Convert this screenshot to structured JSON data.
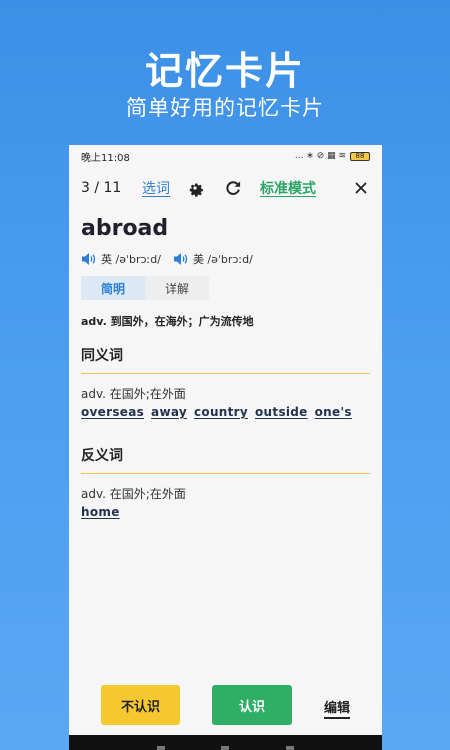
{
  "hero": {
    "title": "记忆卡片",
    "subtitle": "简单好用的记忆卡片"
  },
  "status_bar": {
    "time": "晚上11:08",
    "icons": "... ∗ ⊘ ▦ ≋",
    "battery": "88"
  },
  "toolbar": {
    "counter": "3 / 11",
    "select_word": "选词",
    "mode": "标准模式",
    "icons": [
      "gear-icon",
      "refresh-icon",
      "close-icon"
    ]
  },
  "card": {
    "word": "abroad",
    "pronunciations": [
      {
        "label": "英 /əˈbrɔːd/"
      },
      {
        "label": "美 /əˈbrɔːd/"
      }
    ],
    "tabs": [
      "简明",
      "详解"
    ],
    "definition": "adv. 到国外，在海外；广为流传地",
    "synonyms": {
      "title": "同义词",
      "pos_def": "adv. 在国外;在外面",
      "words": [
        "overseas",
        "away",
        "country",
        "outside",
        "one's"
      ]
    },
    "antonyms": {
      "title": "反义词",
      "pos_def": "adv. 在国外;在外面",
      "words": [
        "home"
      ]
    }
  },
  "actions": {
    "unknown": "不认识",
    "known": "认识",
    "edit": "编辑"
  },
  "colors": {
    "accent_blue": "#2d7fd6",
    "accent_green": "#2aa568",
    "yellow": "#f5c830",
    "button_green": "#2fae66"
  }
}
